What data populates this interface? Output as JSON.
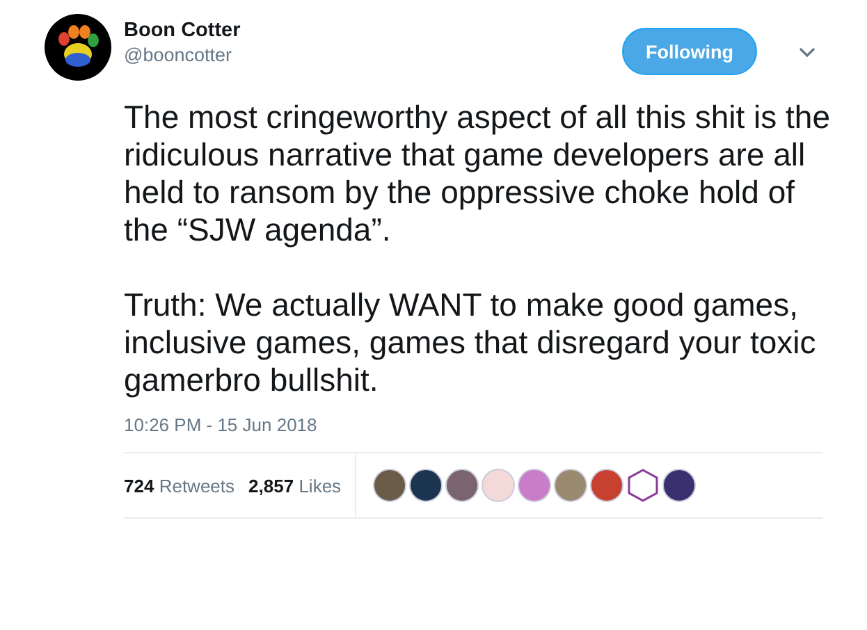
{
  "author": {
    "name": "Boon Cotter",
    "handle": "@booncotter"
  },
  "follow_button": {
    "label": "Following",
    "selected": true
  },
  "tweet": {
    "paragraphs": [
      "The most cringeworthy aspect of all this shit is the ridiculous narrative that game developers are all held to ransom by the oppressive choke hold of the “SJW agenda”.",
      "Truth: We actually WANT to make good games, inclusive games, games that disregard your toxic gamerbro bullshit."
    ]
  },
  "timestamp": "10:26 PM - 15 Jun 2018",
  "stats": [
    {
      "count": "724",
      "label": "Retweets"
    },
    {
      "count": "2,857",
      "label": "Likes"
    }
  ],
  "likers": [
    {
      "kind": "circle"
    },
    {
      "kind": "circle"
    },
    {
      "kind": "circle"
    },
    {
      "kind": "circle"
    },
    {
      "kind": "circle"
    },
    {
      "kind": "circle"
    },
    {
      "kind": "circle"
    },
    {
      "kind": "hexagon"
    },
    {
      "kind": "circle"
    }
  ]
}
